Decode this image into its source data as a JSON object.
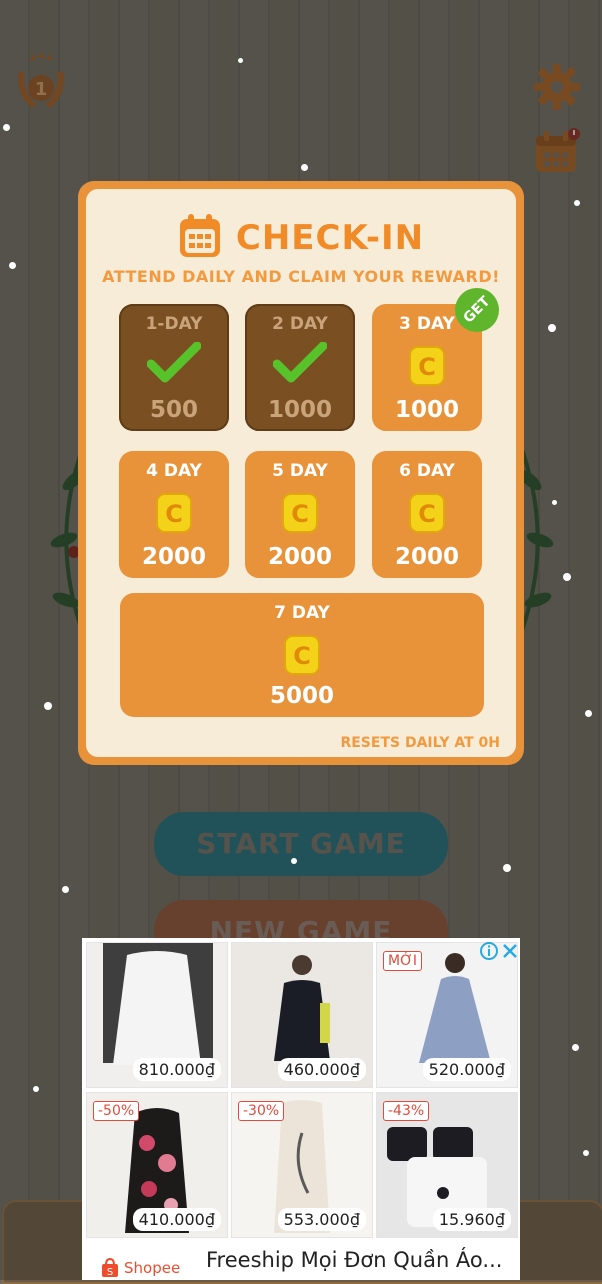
{
  "hud": {
    "level_badge": "1",
    "gear_icon": "gear-icon",
    "calendar_icon": "calendar-icon"
  },
  "modal": {
    "title": "CHECK-IN",
    "subtitle": "ATTEND DAILY AND CLAIM YOUR REWARD!",
    "get_label": "GET",
    "resets_text": "RESETS DAILY AT 0H",
    "days": [
      {
        "label": "1-DAY",
        "amount": "500",
        "claimed": true
      },
      {
        "label": "2 DAY",
        "amount": "1000",
        "claimed": true
      },
      {
        "label": "3 DAY",
        "amount": "1000",
        "claimed": false
      },
      {
        "label": "4 DAY",
        "amount": "2000",
        "claimed": false
      },
      {
        "label": "5 DAY",
        "amount": "2000",
        "claimed": false
      },
      {
        "label": "6 DAY",
        "amount": "2000",
        "claimed": false
      },
      {
        "label": "7 DAY",
        "amount": "5000",
        "claimed": false
      }
    ]
  },
  "menu": {
    "start_game": "START GAME",
    "new_game": "NEW GAME"
  },
  "ad": {
    "items": [
      {
        "price": "810.000₫",
        "tag": ""
      },
      {
        "price": "460.000₫",
        "tag": ""
      },
      {
        "price": "520.000₫",
        "tag": "MỚI"
      },
      {
        "price": "410.000₫",
        "tag": "-50%"
      },
      {
        "price": "553.000₫",
        "tag": "-30%"
      },
      {
        "price": "15.960₫",
        "tag": "-43%"
      }
    ],
    "brand": "Shopee",
    "title": "Freeship Mọi Đơn Quần Áo..."
  },
  "colors": {
    "accent": "#e8923a",
    "modal_bg": "#f7ecd8",
    "claimed": "#7a4f22",
    "get_badge": "#5fb52c"
  }
}
